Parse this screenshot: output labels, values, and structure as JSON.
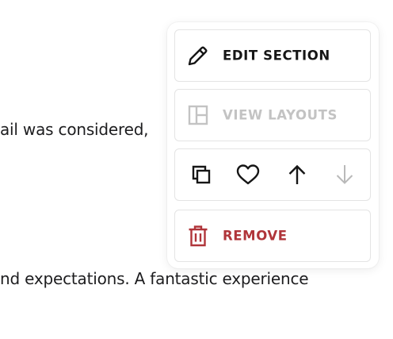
{
  "page": {
    "text_line_1": "ail was considered,",
    "text_line_2": "nd expectations. A fantastic experience"
  },
  "menu": {
    "edit_section": {
      "label": "EDIT SECTION",
      "icon": "pencil-icon",
      "enabled": true
    },
    "view_layouts": {
      "label": "VIEW LAYOUTS",
      "icon": "layout-icon",
      "enabled": false
    },
    "actions": [
      {
        "icon": "duplicate-icon",
        "enabled": true
      },
      {
        "icon": "heart-icon",
        "enabled": true
      },
      {
        "icon": "arrow-up-icon",
        "enabled": true
      },
      {
        "icon": "arrow-down-icon",
        "enabled": false
      }
    ],
    "remove": {
      "label": "REMOVE",
      "icon": "trash-icon",
      "enabled": true
    }
  },
  "colors": {
    "text": "#161616",
    "disabled": "#c3c3c3",
    "danger": "#b0353a",
    "border": "#e4e4e4"
  }
}
